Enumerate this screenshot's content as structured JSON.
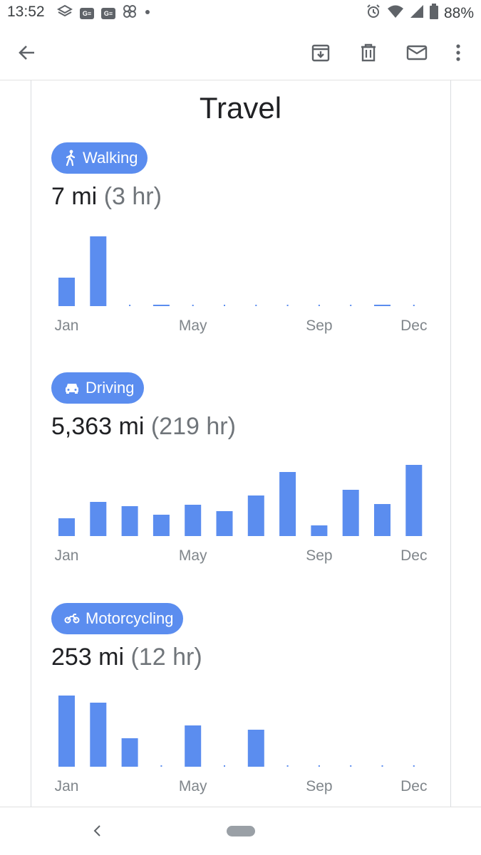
{
  "status_bar": {
    "time": "13:52",
    "battery": "88%",
    "left_icons": [
      "stack-icon",
      "notification-badge-icon",
      "notification-badge-icon",
      "pinwheel-icon",
      "dot-icon"
    ],
    "right_icons": [
      "alarm-icon",
      "wifi-icon",
      "signal-icon",
      "battery-icon"
    ],
    "badge_text": "G≡"
  },
  "app_bar": {
    "icons": [
      "back-arrow-icon",
      "archive-icon",
      "delete-icon",
      "mail-icon",
      "more-vert-icon"
    ]
  },
  "card": {
    "title": "Travel"
  },
  "sections": [
    {
      "id": "walking",
      "label": "Walking",
      "icon": "walking-icon",
      "distance": "7 mi",
      "duration": "(3 hr)"
    },
    {
      "id": "driving",
      "label": "Driving",
      "icon": "car-icon",
      "distance": "5,363 mi",
      "duration": "(219 hr)"
    },
    {
      "id": "motorcycling",
      "label": "Motorcycling",
      "icon": "motorcycle-icon",
      "distance": "253 mi",
      "duration": "(12 hr)"
    }
  ],
  "chart_data": [
    {
      "type": "bar",
      "series": [
        {
          "values": [
            2.0,
            4.9,
            0,
            0.05,
            0,
            0,
            0,
            0,
            0,
            0,
            0.05,
            0
          ]
        }
      ],
      "categories": [
        "Jan",
        "Feb",
        "Mar",
        "Apr",
        "May",
        "Jun",
        "Jul",
        "Aug",
        "Sep",
        "Oct",
        "Nov",
        "Dec"
      ],
      "tick_labels": [
        "Jan",
        "May",
        "Sep",
        "Dec"
      ],
      "tick_indices": [
        0,
        4,
        8,
        11
      ],
      "ymax": 5
    },
    {
      "type": "bar",
      "series": [
        {
          "values": [
            250,
            480,
            420,
            300,
            440,
            350,
            570,
            900,
            150,
            650,
            450,
            1000
          ]
        }
      ],
      "categories": [
        "Jan",
        "Feb",
        "Mar",
        "Apr",
        "May",
        "Jun",
        "Jul",
        "Aug",
        "Sep",
        "Oct",
        "Nov",
        "Dec"
      ],
      "tick_labels": [
        "Jan",
        "May",
        "Sep",
        "Dec"
      ],
      "tick_indices": [
        0,
        4,
        8,
        11
      ],
      "ymax": 1000
    },
    {
      "type": "bar",
      "series": [
        {
          "values": [
            100,
            90,
            40,
            0,
            58,
            0,
            52,
            0,
            0,
            0,
            0,
            0
          ]
        }
      ],
      "categories": [
        "Jan",
        "Feb",
        "Mar",
        "Apr",
        "May",
        "Jun",
        "Jul",
        "Aug",
        "Sep",
        "Oct",
        "Nov",
        "Dec"
      ],
      "tick_labels": [
        "Jan",
        "May",
        "Sep",
        "Dec"
      ],
      "tick_indices": [
        0,
        4,
        8,
        11
      ],
      "ymax": 100
    }
  ],
  "colors": {
    "bar": "#5b8def",
    "chip": "#5b8def",
    "tick_label": "#80868b",
    "duration_text": "#70757a"
  }
}
